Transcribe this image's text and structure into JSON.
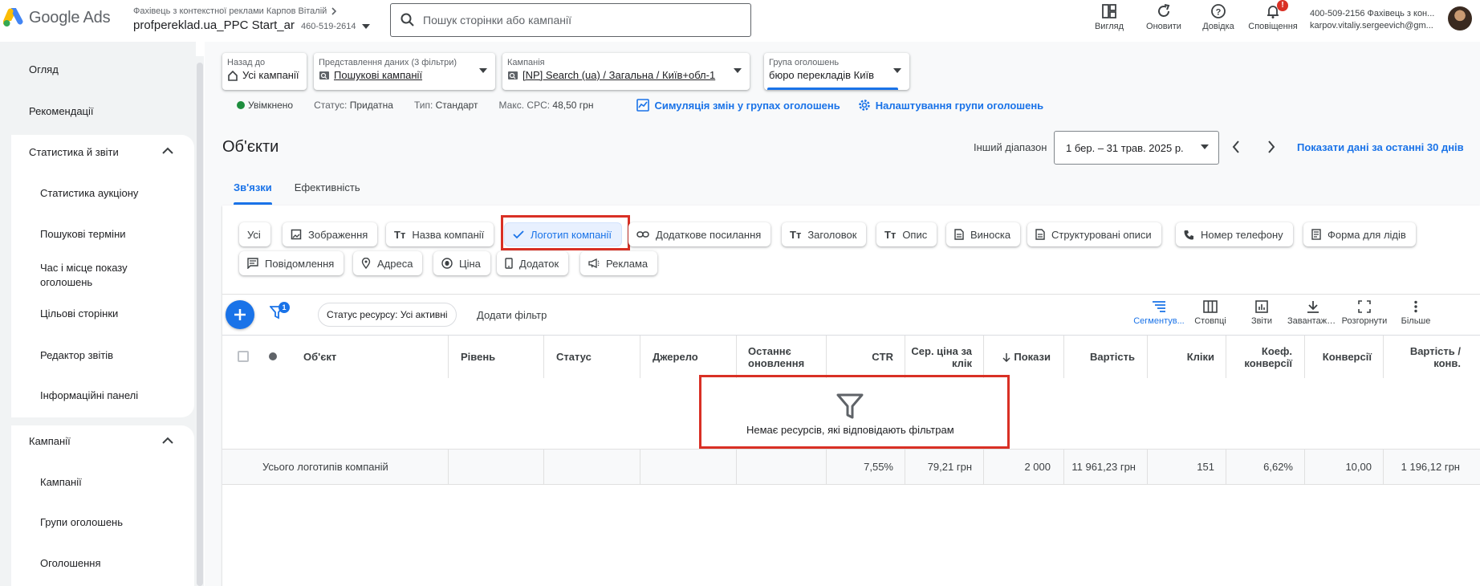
{
  "header": {
    "logo_text": "Google Ads",
    "account_owner": "Фахівець з контекстної реклами Карпов Віталій",
    "account_name": "profpereklad.ua_PPC Start_ar",
    "account_id": "460-519-2614",
    "search_placeholder": "Пошук сторінки або кампанії",
    "actions": [
      {
        "label": "Вигляд",
        "icon": "appearance-icon"
      },
      {
        "label": "Оновити",
        "icon": "refresh-icon"
      },
      {
        "label": "Довідка",
        "icon": "help-icon"
      },
      {
        "label": "Сповіщення",
        "icon": "bell-icon",
        "badge": "!"
      }
    ],
    "user_line1": "400-509-2156 Фахівець з кон...",
    "user_line2": "karpov.vitaliy.sergeevich@gm..."
  },
  "sidebar": {
    "overview": "Огляд",
    "recommendations": "Рекомендації",
    "stats_group": "Статистика й звіти",
    "stats_items": [
      "Статистика аукціону",
      "Пошукові терміни",
      "Час і місце показу оголошень",
      "Цільові сторінки",
      "Редактор звітів",
      "Інформаційні панелі"
    ],
    "campaigns_group": "Кампанії",
    "campaigns_items": [
      "Кампанії",
      "Групи оголошень",
      "Оголошення"
    ]
  },
  "pickers": {
    "back": {
      "label": "Назад до",
      "value": "Усі кампанії"
    },
    "view": {
      "label": "Представлення даних (3 фільтри)",
      "value": "Пошукові кампанії"
    },
    "campaign": {
      "label": "Кампанія",
      "value": "[NP] Search (ua) / Загальна / Київ+обл-1"
    },
    "adgroup": {
      "label": "Група оголошень",
      "value": "бюро перекладів Київ"
    }
  },
  "status_line": {
    "enabled": "Увімкнено",
    "status_key": "Статус:",
    "status_val": "Придатна",
    "type_key": "Тип:",
    "type_val": "Стандарт",
    "cpc_key": "Макс. CPC:",
    "cpc_val": "48,50 грн",
    "simulation_link": "Симуляція змін у групах оголошень",
    "settings_link": "Налаштування групи оголошень"
  },
  "page": {
    "title": "Об'єкти",
    "range_label": "Інший діапазон",
    "range_value": "1 бер. – 31 трав. 2025 р.",
    "last30": "Показати дані за останні 30 днів",
    "tabs": [
      "Зв'язки",
      "Ефективність"
    ]
  },
  "chips": [
    {
      "label": "Усі",
      "icon": ""
    },
    {
      "label": "Зображення",
      "icon": "image-icon"
    },
    {
      "label": "Назва компанії",
      "icon": "text-icon"
    },
    {
      "label": "Логотип компанії",
      "icon": "check-icon",
      "selected": true
    },
    {
      "label": "Додаткове посилання",
      "icon": "link-icon"
    },
    {
      "label": "Заголовок",
      "icon": "text-icon"
    },
    {
      "label": "Опис",
      "icon": "text-icon"
    },
    {
      "label": "Виноска",
      "icon": "doc-icon"
    },
    {
      "label": "Структуровані описи",
      "icon": "doc-icon"
    },
    {
      "label": "Номер телефону",
      "icon": "phone-icon"
    },
    {
      "label": "Форма для лідів",
      "icon": "form-icon"
    },
    {
      "label": "Повідомлення",
      "icon": "message-icon"
    },
    {
      "label": "Адреса",
      "icon": "pin-icon"
    },
    {
      "label": "Ціна",
      "icon": "price-icon"
    },
    {
      "label": "Додаток",
      "icon": "app-icon"
    },
    {
      "label": "Реклама",
      "icon": "megaphone-icon"
    }
  ],
  "toolbar": {
    "filter_count": "1",
    "status_chip": "Статус ресурсу: Усі активні",
    "add_filter": "Додати фільтр",
    "tools": [
      "Сегментув...",
      "Стовпці",
      "Звіти",
      "Завантажи...",
      "Розгорнути",
      "Більше"
    ]
  },
  "table": {
    "headers": [
      "Об'єкт",
      "Рівень",
      "Статус",
      "Джерело",
      "Останнє оновлення",
      "CTR",
      "Сер. ціна за клік",
      "Покази",
      "Вартість",
      "Кліки",
      "Коеф. конверсії",
      "Конверсії",
      "Вартість / конв."
    ],
    "empty_message": "Немає ресурсів, які відповідають фільтрам",
    "total_label": "Усього логотипів компаній",
    "totals": [
      "7,55%",
      "79,21 грн",
      "2 000",
      "11 961,23 грн",
      "151",
      "6,62%",
      "10,00",
      "1 196,12 грн"
    ]
  },
  "colors": {
    "accent": "#1a73e8",
    "highlight": "#d93025",
    "enabled": "#1e8e3e"
  }
}
